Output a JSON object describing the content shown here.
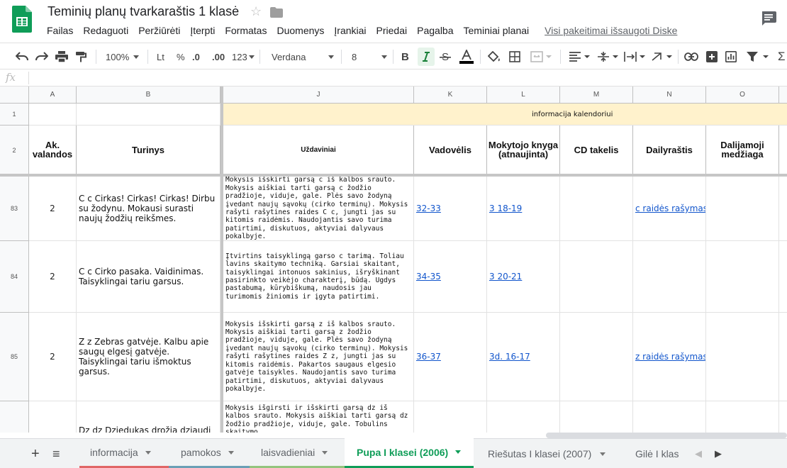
{
  "doc": {
    "title": "Teminių planų tvarkaraštis 1 klasė",
    "saved_status": "Visi pakeitimai išsaugoti Diske",
    "menu": [
      "Failas",
      "Redaguoti",
      "Peržiūrėti",
      "Įterpti",
      "Formatas",
      "Duomenys",
      "Įrankiai",
      "Priedai",
      "Pagalba",
      "Teminiai planai"
    ]
  },
  "toolbar": {
    "zoom": "100%",
    "currency": "Lt",
    "percent": "%",
    "dec_less": ".0",
    "dec_more": ".00",
    "more_formats": "123",
    "font": "Verdana",
    "font_size": "8",
    "bold": "B"
  },
  "formula_bar": {
    "fx": "fx",
    "value": ""
  },
  "columns": [
    "A",
    "B",
    "J",
    "K",
    "L",
    "M",
    "N",
    "O"
  ],
  "header_banner": "informacija kalendoriui",
  "headers": {
    "a": "Ak. valandos",
    "b": "Turinys",
    "j": "Uždaviniai",
    "k": "Vadovėlis",
    "l": "Mokytojo knyga (atnaujinta)",
    "m": "CD takelis",
    "n": "Dailyraštis",
    "o": "Dalijamoji medžiaga"
  },
  "rows": [
    {
      "num": "83",
      "hours": "2",
      "content": "C c Cirkas! Cirkas! Cirkas! Dirbu su žodynu. Mokausi surasti naujų žodžių reikšmes.",
      "tasks": "Mokysis išskirti garsą c iš kalbos srauto. Mokysis aiškiai tarti garsą c žodžio pradžioje, viduje, gale. Plės savo žodyną įvedant naujų sąvokų (cirko terminų). Mokysis rašyti rašytines raides C c, jungti jas su kitomis raidėmis. Naudojantis savo turima patirtimi, diskutuos, aktyviai dalyvaus pokalbyje.",
      "textbook": "32-33",
      "teacher_book": "3 18-19",
      "cd": "",
      "calligraphy": "c raidės rašymas",
      "handout": ""
    },
    {
      "num": "84",
      "hours": "2",
      "content": "C c Cirko pasaka. Vaidinimas. Taisyklingai tariu garsus.",
      "tasks": "Įtvirtins taisyklingą garso c tarimą. Toliau lavins skaitymo techniką. Garsiai skaitant, taisyklingai intonuos sakinius, išryškinant pasirinkto veikėjo charakterį, būdą. Ugdys pastabumą, kūrybiškumą, naudosis jau turimomis žiniomis ir įgyta patirtimi.",
      "textbook": "34-35",
      "teacher_book": "3 20-21",
      "cd": "",
      "calligraphy": "",
      "handout": ""
    },
    {
      "num": "85",
      "hours": "2",
      "content": "Z z Zebras gatvėje. Kalbu apie saugų elgesį gatvėje. Taisyklingai tariu išmoktus garsus.",
      "tasks": "Mokysis išskirti garsą z iš kalbos srauto. Mokysis aiškiai tarti garsą z žodžio pradžioje, viduje, gale. Plės savo žodyną įvedant naujų sąvokų (cirko terminų). Mokysis rašyti rašytines raides Z z, jungti jas su kitomis raidėmis. Pakartos saugaus elgesio gatvėje taisykles. Naudojantis savo turima patirtimi, diskutuos, aktyviai dalyvaus pokalbyje.",
      "textbook": "36-37",
      "teacher_book": "3d. 16-17",
      "cd": "",
      "calligraphy": "z raidės rašymas",
      "handout": ""
    },
    {
      "num": "",
      "hours": "",
      "content": "Dz dz Dziedukas drožia dziaudį",
      "tasks": "Mokysis išgirsti ir išskirti garsą dz iš kalbos srauto. Mokysis aiškiai tarti garsą dz žodžio pradžioje, viduje, gale. Tobulins skaitymo",
      "textbook": "",
      "teacher_book": "",
      "cd": "",
      "calligraphy": "",
      "handout": ""
    }
  ],
  "sheets": {
    "add": "+",
    "list": "≡",
    "tabs": [
      {
        "label": "informacija",
        "color": "#e06666"
      },
      {
        "label": "pamokos",
        "color": "#6a9fb5"
      },
      {
        "label": "laisvadieniai",
        "color": "#93c47d"
      },
      {
        "label": "Pupa I klasei (2006)",
        "color": "#0f9d58",
        "active": true
      },
      {
        "label": "Riešutas I klasei (2007)",
        "color": ""
      },
      {
        "label": "Gilė I klas",
        "color": ""
      }
    ]
  },
  "colors": {
    "sheets_green": "#0f9d58",
    "banner": "#fff2cc",
    "link": "#1155cc"
  }
}
